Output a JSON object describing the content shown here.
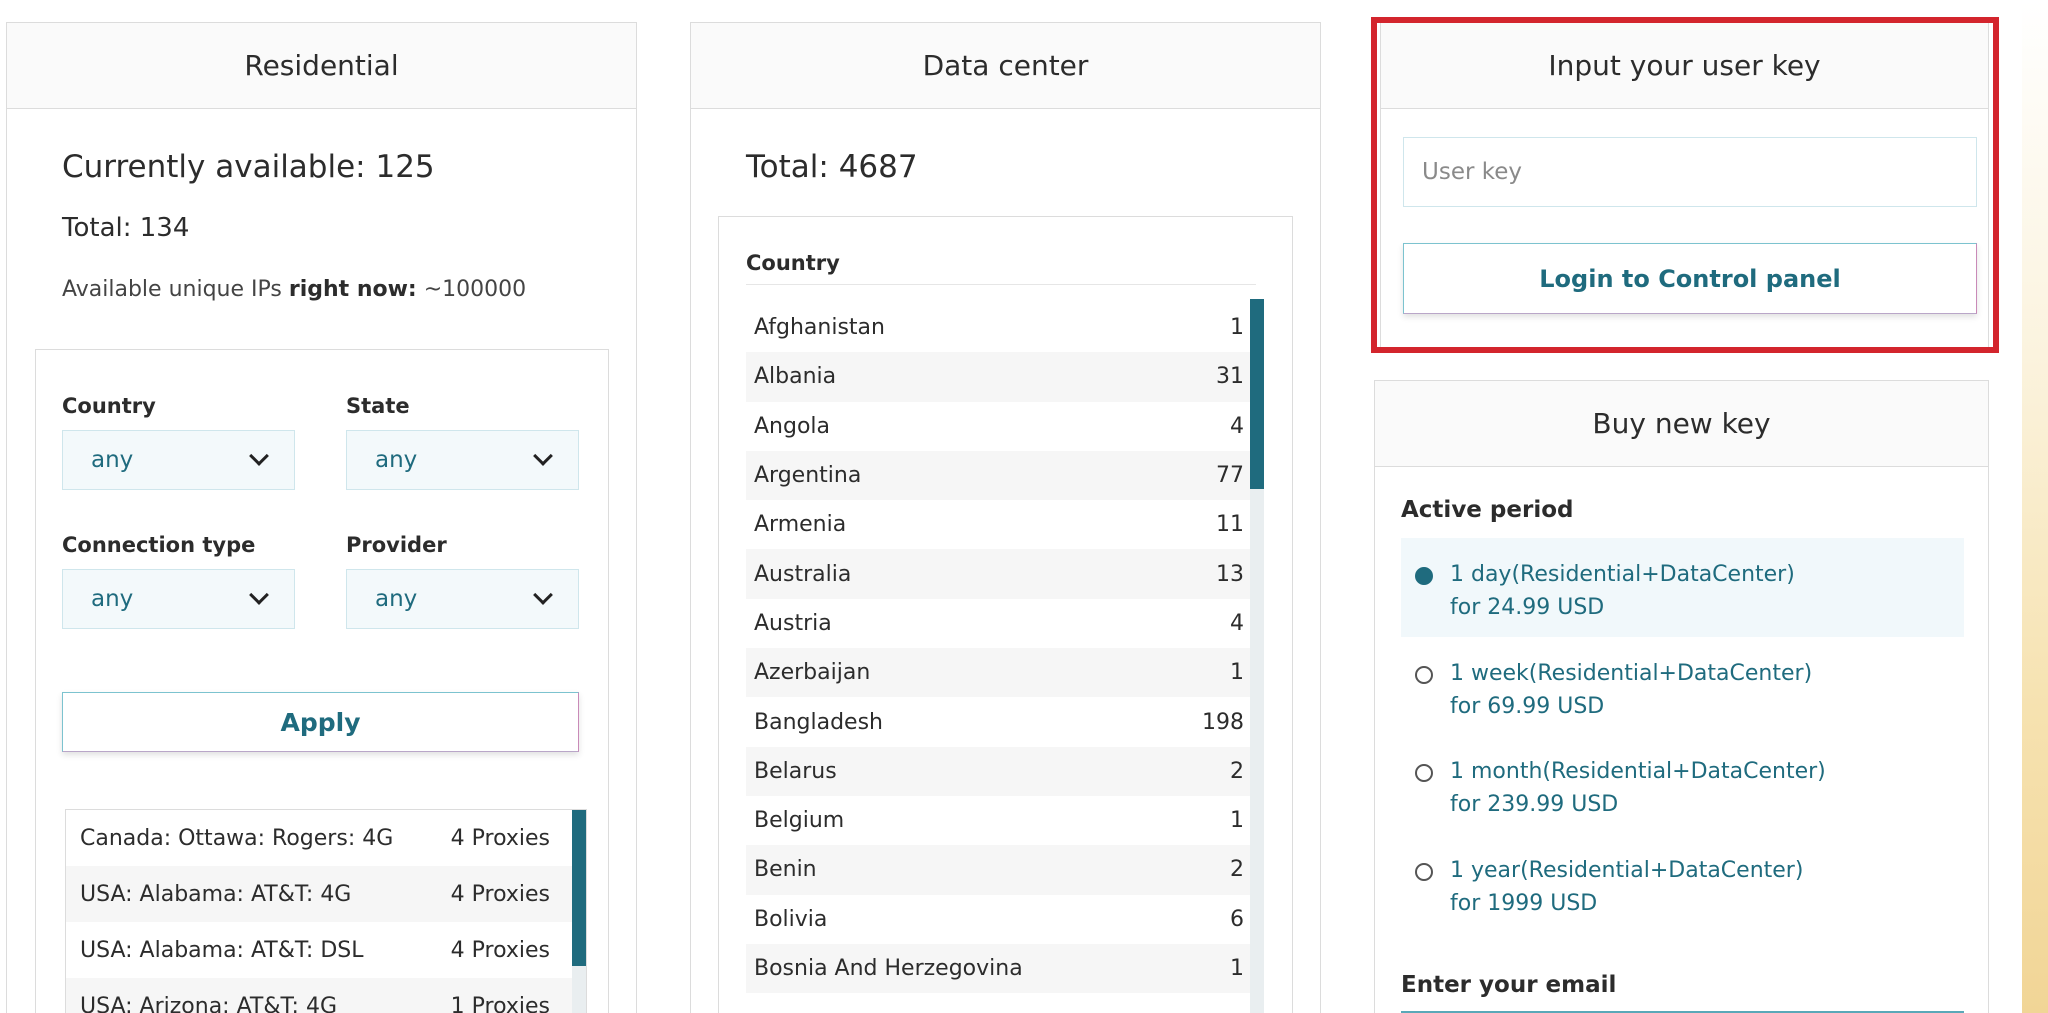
{
  "residential": {
    "title": "Residential",
    "currently_available": "Currently available: 125",
    "total": "Total: 134",
    "unique_ips_prefix": "Available unique IPs ",
    "unique_ips_bold": "right now:",
    "unique_ips_value": " ~100000",
    "filters": {
      "country_label": "Country",
      "country_value": "any",
      "state_label": "State",
      "state_value": "any",
      "connection_label": "Connection type",
      "connection_value": "any",
      "provider_label": "Provider",
      "provider_value": "any",
      "apply_label": "Apply"
    },
    "proxies": [
      {
        "location": "Canada: Ottawa: Rogers: 4G",
        "count": "4 Proxies"
      },
      {
        "location": "USA: Alabama: AT&T: 4G",
        "count": "4 Proxies"
      },
      {
        "location": "USA: Alabama: AT&T: DSL",
        "count": "4 Proxies"
      },
      {
        "location": "USA: Arizona: AT&T: 4G",
        "count": "1 Proxies"
      }
    ]
  },
  "datacenter": {
    "title": "Data center",
    "total": "Total: 4687",
    "country_header": "Country",
    "countries": [
      {
        "name": "Afghanistan",
        "count": "1"
      },
      {
        "name": "Albania",
        "count": "31"
      },
      {
        "name": "Angola",
        "count": "4"
      },
      {
        "name": "Argentina",
        "count": "77"
      },
      {
        "name": "Armenia",
        "count": "11"
      },
      {
        "name": "Australia",
        "count": "13"
      },
      {
        "name": "Austria",
        "count": "4"
      },
      {
        "name": "Azerbaijan",
        "count": "1"
      },
      {
        "name": "Bangladesh",
        "count": "198"
      },
      {
        "name": "Belarus",
        "count": "2"
      },
      {
        "name": "Belgium",
        "count": "1"
      },
      {
        "name": "Benin",
        "count": "2"
      },
      {
        "name": "Bolivia",
        "count": "6"
      },
      {
        "name": "Bosnia And Herzegovina",
        "count": "1"
      }
    ]
  },
  "login": {
    "title": "Input your user key",
    "placeholder": "User key",
    "button": "Login to Control panel"
  },
  "buy": {
    "title": "Buy new key",
    "period_label": "Active period",
    "plans": [
      {
        "line1": "1 day(Residential+DataCenter)",
        "line2": "for 24.99 USD",
        "selected": true
      },
      {
        "line1": "1 week(Residential+DataCenter)",
        "line2": "for 69.99 USD",
        "selected": false
      },
      {
        "line1": "1 month(Residential+DataCenter)",
        "line2": "for 239.99 USD",
        "selected": false
      },
      {
        "line1": "1 year(Residential+DataCenter)",
        "line2": "for 1999 USD",
        "selected": false
      }
    ],
    "email_label": "Enter your email"
  },
  "colors": {
    "accent": "#1f6b7e",
    "highlight": "#d3252d"
  }
}
